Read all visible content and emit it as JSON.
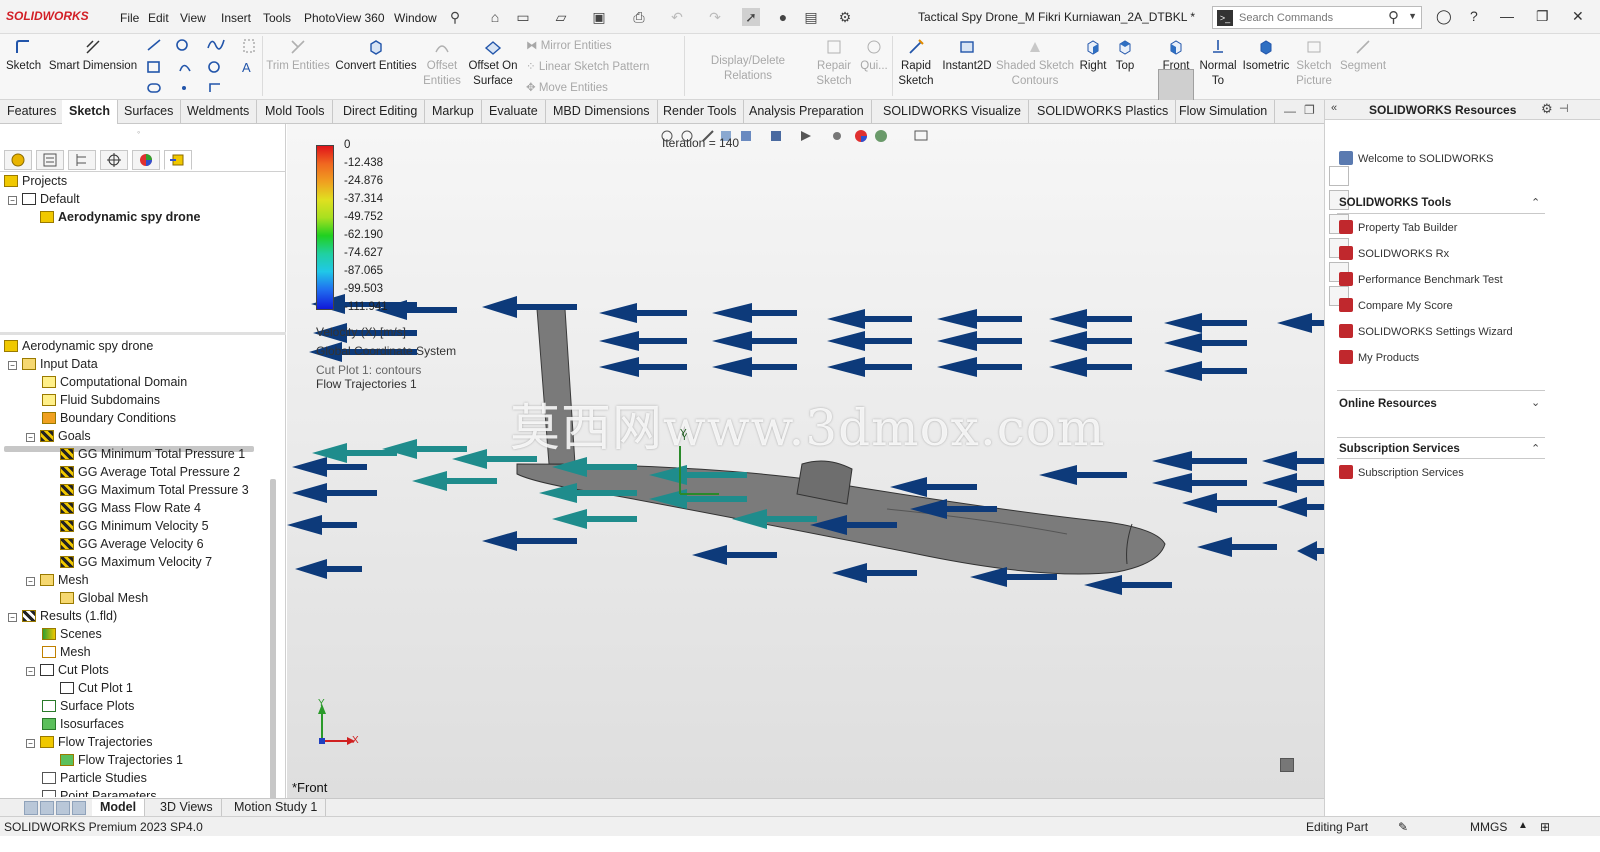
{
  "app": {
    "logo": "SOLIDWORKS",
    "document_title": "Tactical Spy Drone_M Fikri Kurniawan_2A_DTBKL *"
  },
  "menu": [
    "File",
    "Edit",
    "View",
    "Insert",
    "Tools",
    "PhotoView 360",
    "Window"
  ],
  "search": {
    "placeholder": "Search Commands"
  },
  "ribbon": {
    "sketch": "Sketch",
    "smart_dimension": "Smart Dimension",
    "trim_entities": "Trim Entities",
    "convert_entities": "Convert Entities",
    "offset_entities_1": "Offset",
    "offset_entities_2": "Entities",
    "offset_on_surface_1": "Offset On",
    "offset_on_surface_2": "Surface",
    "mirror_entities": "Mirror Entities",
    "linear_sketch_pattern": "Linear Sketch Pattern",
    "move_entities": "Move Entities",
    "display_delete_relations": "Display/Delete Relations",
    "repair_sketch_1": "Repair",
    "repair_sketch_2": "Sketch",
    "quick_snaps": "Qui...",
    "rapid_sketch_1": "Rapid",
    "rapid_sketch_2": "Sketch",
    "instant2d": "Instant2D",
    "shaded_sketch_1": "Shaded Sketch",
    "shaded_sketch_2": "Contours",
    "right": "Right",
    "top": "Top",
    "front": "Front",
    "normal_to_1": "Normal",
    "normal_to_2": "To",
    "isometric": "Isometric",
    "sketch_picture_1": "Sketch",
    "sketch_picture_2": "Picture",
    "segment": "Segment"
  },
  "tabs": [
    "Features",
    "Sketch",
    "Surfaces",
    "Weldments",
    "Mold Tools",
    "Direct Editing",
    "Markup",
    "Evaluate",
    "MBD Dimensions",
    "Render Tools",
    "Analysis Preparation",
    "SOLIDWORKS Visualize",
    "SOLIDWORKS Plastics",
    "Flow Simulation"
  ],
  "active_tab": "Sketch",
  "projects_tree": {
    "root": "Projects",
    "default": "Default",
    "project": "Aerodynamic spy drone"
  },
  "analysis_tree": {
    "root": "Aerodynamic spy drone",
    "input_data": "Input Data",
    "computational_domain": "Computational Domain",
    "fluid_subdomains": "Fluid Subdomains",
    "boundary_conditions": "Boundary Conditions",
    "goals": "Goals",
    "goal_items": [
      "GG Minimum Total Pressure 1",
      "GG Average Total Pressure 2",
      "GG Maximum Total Pressure 3",
      "GG Mass Flow Rate 4",
      "GG Minimum Velocity 5",
      "GG Average Velocity 6",
      "GG Maximum Velocity 7"
    ],
    "mesh": "Mesh",
    "global_mesh": "Global Mesh",
    "results": "Results (1.fld)",
    "scenes": "Scenes",
    "results_mesh": "Mesh",
    "cut_plots": "Cut Plots",
    "cut_plot_1": "Cut Plot 1",
    "surface_plots": "Surface Plots",
    "isosurfaces": "Isosurfaces",
    "flow_trajectories": "Flow Trajectories",
    "flow_trajectories_1": "Flow Trajectories 1",
    "particle_studies": "Particle Studies",
    "point_parameters": "Point Parameters"
  },
  "legend": {
    "values": [
      "0",
      "-12.438",
      "-24.876",
      "-37.314",
      "-49.752",
      "-62.190",
      "-74.627",
      "-87.065",
      "-99.503",
      "-111.941"
    ],
    "quantity": "Velocity (X) [m/s]",
    "coord_system": "Global Coordinate System",
    "cut_plot": "Cut Plot 1: contours",
    "flow_traj": "Flow Trajectories 1"
  },
  "viewport": {
    "iteration": "Iteration = 140",
    "view_label": "*Front",
    "watermark": "莫西网www.3dmox.com",
    "axis_y": "Y",
    "axis_x": "X"
  },
  "bottom_tabs": [
    "Model",
    "3D Views",
    "Motion Study 1"
  ],
  "active_bottom_tab": "Model",
  "status": {
    "version": "SOLIDWORKS Premium 2023 SP4.0",
    "mode": "Editing Part",
    "units": "MMGS"
  },
  "resources": {
    "title": "SOLIDWORKS Resources",
    "welcome": "Welcome to SOLIDWORKS",
    "tools_header": "SOLIDWORKS Tools",
    "tools": [
      "Property Tab Builder",
      "SOLIDWORKS Rx",
      "Performance Benchmark Test",
      "Compare My Score",
      "SOLIDWORKS Settings Wizard",
      "My Products"
    ],
    "online_header": "Online Resources",
    "subscription_header": "Subscription Services",
    "subscription_item": "Subscription Services"
  },
  "colors": {
    "accent_red": "#d21f26",
    "arrow_blue": "#0d3a7a",
    "arrow_teal": "#1f8c8c",
    "drone_gray": "#7a7a7a"
  }
}
